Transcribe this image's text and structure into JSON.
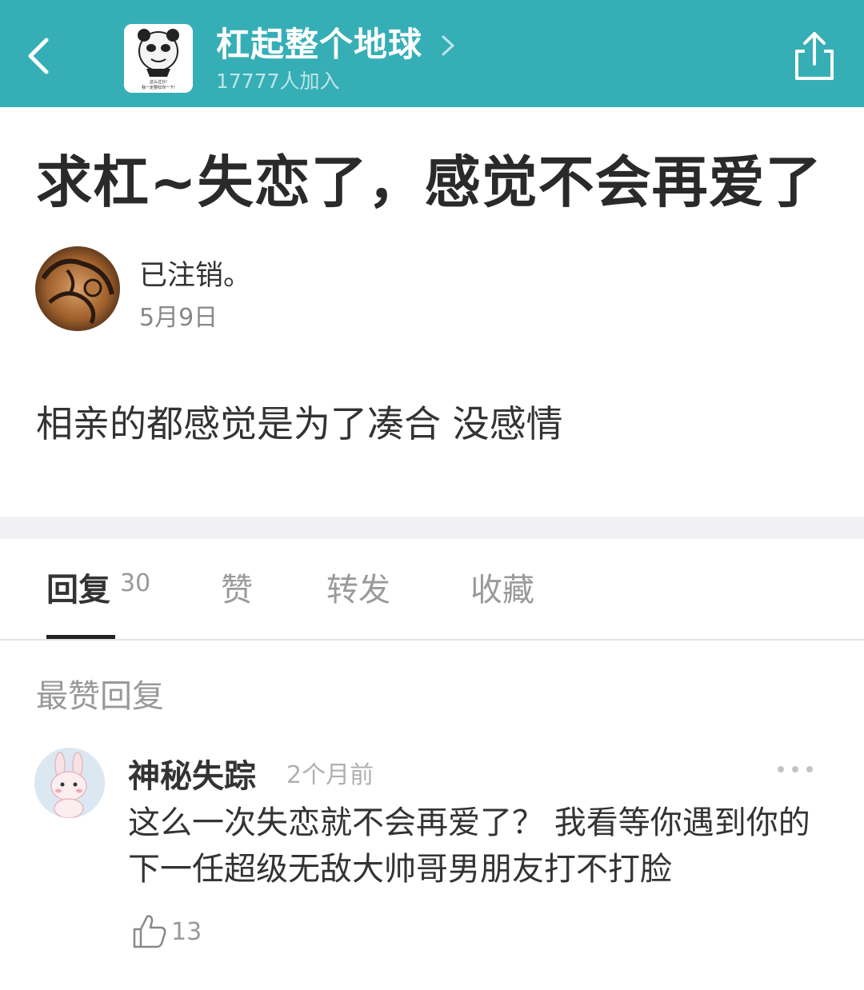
{
  "header": {
    "group_name": "杠起整个地球",
    "member_count": "17777人加入",
    "group_avatar_caption_1": "这么过分!",
    "group_avatar_caption_2": "我一定要杠你一下!",
    "accent_color": "#36aeb6"
  },
  "post": {
    "title": "求杠~失恋了，感觉不会再爱了",
    "author": "已注销。",
    "date": "5月9日",
    "body": "相亲的都感觉是为了凑合 没感情"
  },
  "tabs": [
    {
      "label": "回复",
      "count": "30",
      "active": true
    },
    {
      "label": "赞",
      "active": false
    },
    {
      "label": "转发",
      "active": false
    },
    {
      "label": "收藏",
      "active": false
    }
  ],
  "replies_section": {
    "label": "最赞回复",
    "items": [
      {
        "author": "神秘失踪",
        "time": "2个月前",
        "text": "这么一次失恋就不会再爱了？ 我看等你遇到你的下一任超级无敌大帅哥男朋友打不打脸",
        "likes": "13"
      }
    ]
  }
}
